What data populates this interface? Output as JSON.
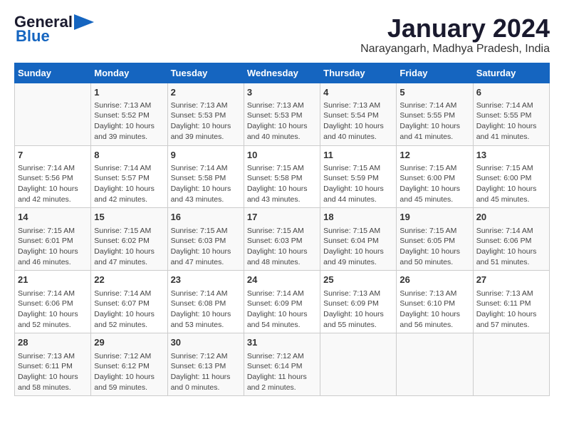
{
  "logo": {
    "line1": "General",
    "line2": "Blue"
  },
  "title": "January 2024",
  "subtitle": "Narayangarh, Madhya Pradesh, India",
  "days_of_week": [
    "Sunday",
    "Monday",
    "Tuesday",
    "Wednesday",
    "Thursday",
    "Friday",
    "Saturday"
  ],
  "weeks": [
    [
      {
        "day": "",
        "info": ""
      },
      {
        "day": "1",
        "info": "Sunrise: 7:13 AM\nSunset: 5:52 PM\nDaylight: 10 hours\nand 39 minutes."
      },
      {
        "day": "2",
        "info": "Sunrise: 7:13 AM\nSunset: 5:53 PM\nDaylight: 10 hours\nand 39 minutes."
      },
      {
        "day": "3",
        "info": "Sunrise: 7:13 AM\nSunset: 5:53 PM\nDaylight: 10 hours\nand 40 minutes."
      },
      {
        "day": "4",
        "info": "Sunrise: 7:13 AM\nSunset: 5:54 PM\nDaylight: 10 hours\nand 40 minutes."
      },
      {
        "day": "5",
        "info": "Sunrise: 7:14 AM\nSunset: 5:55 PM\nDaylight: 10 hours\nand 41 minutes."
      },
      {
        "day": "6",
        "info": "Sunrise: 7:14 AM\nSunset: 5:55 PM\nDaylight: 10 hours\nand 41 minutes."
      }
    ],
    [
      {
        "day": "7",
        "info": "Sunrise: 7:14 AM\nSunset: 5:56 PM\nDaylight: 10 hours\nand 42 minutes."
      },
      {
        "day": "8",
        "info": "Sunrise: 7:14 AM\nSunset: 5:57 PM\nDaylight: 10 hours\nand 42 minutes."
      },
      {
        "day": "9",
        "info": "Sunrise: 7:14 AM\nSunset: 5:58 PM\nDaylight: 10 hours\nand 43 minutes."
      },
      {
        "day": "10",
        "info": "Sunrise: 7:15 AM\nSunset: 5:58 PM\nDaylight: 10 hours\nand 43 minutes."
      },
      {
        "day": "11",
        "info": "Sunrise: 7:15 AM\nSunset: 5:59 PM\nDaylight: 10 hours\nand 44 minutes."
      },
      {
        "day": "12",
        "info": "Sunrise: 7:15 AM\nSunset: 6:00 PM\nDaylight: 10 hours\nand 45 minutes."
      },
      {
        "day": "13",
        "info": "Sunrise: 7:15 AM\nSunset: 6:00 PM\nDaylight: 10 hours\nand 45 minutes."
      }
    ],
    [
      {
        "day": "14",
        "info": "Sunrise: 7:15 AM\nSunset: 6:01 PM\nDaylight: 10 hours\nand 46 minutes."
      },
      {
        "day": "15",
        "info": "Sunrise: 7:15 AM\nSunset: 6:02 PM\nDaylight: 10 hours\nand 47 minutes."
      },
      {
        "day": "16",
        "info": "Sunrise: 7:15 AM\nSunset: 6:03 PM\nDaylight: 10 hours\nand 47 minutes."
      },
      {
        "day": "17",
        "info": "Sunrise: 7:15 AM\nSunset: 6:03 PM\nDaylight: 10 hours\nand 48 minutes."
      },
      {
        "day": "18",
        "info": "Sunrise: 7:15 AM\nSunset: 6:04 PM\nDaylight: 10 hours\nand 49 minutes."
      },
      {
        "day": "19",
        "info": "Sunrise: 7:15 AM\nSunset: 6:05 PM\nDaylight: 10 hours\nand 50 minutes."
      },
      {
        "day": "20",
        "info": "Sunrise: 7:14 AM\nSunset: 6:06 PM\nDaylight: 10 hours\nand 51 minutes."
      }
    ],
    [
      {
        "day": "21",
        "info": "Sunrise: 7:14 AM\nSunset: 6:06 PM\nDaylight: 10 hours\nand 52 minutes."
      },
      {
        "day": "22",
        "info": "Sunrise: 7:14 AM\nSunset: 6:07 PM\nDaylight: 10 hours\nand 52 minutes."
      },
      {
        "day": "23",
        "info": "Sunrise: 7:14 AM\nSunset: 6:08 PM\nDaylight: 10 hours\nand 53 minutes."
      },
      {
        "day": "24",
        "info": "Sunrise: 7:14 AM\nSunset: 6:09 PM\nDaylight: 10 hours\nand 54 minutes."
      },
      {
        "day": "25",
        "info": "Sunrise: 7:13 AM\nSunset: 6:09 PM\nDaylight: 10 hours\nand 55 minutes."
      },
      {
        "day": "26",
        "info": "Sunrise: 7:13 AM\nSunset: 6:10 PM\nDaylight: 10 hours\nand 56 minutes."
      },
      {
        "day": "27",
        "info": "Sunrise: 7:13 AM\nSunset: 6:11 PM\nDaylight: 10 hours\nand 57 minutes."
      }
    ],
    [
      {
        "day": "28",
        "info": "Sunrise: 7:13 AM\nSunset: 6:11 PM\nDaylight: 10 hours\nand 58 minutes."
      },
      {
        "day": "29",
        "info": "Sunrise: 7:12 AM\nSunset: 6:12 PM\nDaylight: 10 hours\nand 59 minutes."
      },
      {
        "day": "30",
        "info": "Sunrise: 7:12 AM\nSunset: 6:13 PM\nDaylight: 11 hours\nand 0 minutes."
      },
      {
        "day": "31",
        "info": "Sunrise: 7:12 AM\nSunset: 6:14 PM\nDaylight: 11 hours\nand 2 minutes."
      },
      {
        "day": "",
        "info": ""
      },
      {
        "day": "",
        "info": ""
      },
      {
        "day": "",
        "info": ""
      }
    ]
  ]
}
